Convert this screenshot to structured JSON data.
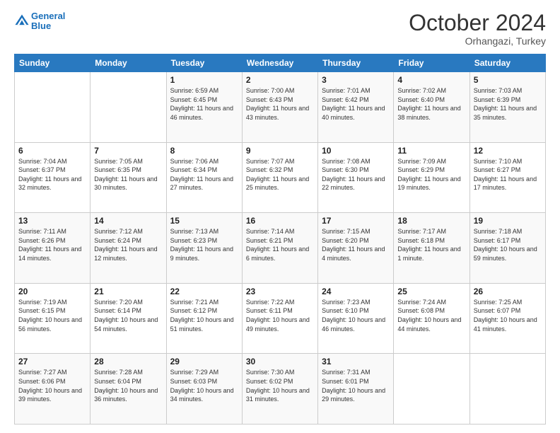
{
  "header": {
    "logo_line1": "General",
    "logo_line2": "Blue",
    "month_title": "October 2024",
    "location": "Orhangazi, Turkey"
  },
  "weekdays": [
    "Sunday",
    "Monday",
    "Tuesday",
    "Wednesday",
    "Thursday",
    "Friday",
    "Saturday"
  ],
  "weeks": [
    [
      {
        "day": "",
        "sunrise": "",
        "sunset": "",
        "daylight": ""
      },
      {
        "day": "",
        "sunrise": "",
        "sunset": "",
        "daylight": ""
      },
      {
        "day": "1",
        "sunrise": "Sunrise: 6:59 AM",
        "sunset": "Sunset: 6:45 PM",
        "daylight": "Daylight: 11 hours and 46 minutes."
      },
      {
        "day": "2",
        "sunrise": "Sunrise: 7:00 AM",
        "sunset": "Sunset: 6:43 PM",
        "daylight": "Daylight: 11 hours and 43 minutes."
      },
      {
        "day": "3",
        "sunrise": "Sunrise: 7:01 AM",
        "sunset": "Sunset: 6:42 PM",
        "daylight": "Daylight: 11 hours and 40 minutes."
      },
      {
        "day": "4",
        "sunrise": "Sunrise: 7:02 AM",
        "sunset": "Sunset: 6:40 PM",
        "daylight": "Daylight: 11 hours and 38 minutes."
      },
      {
        "day": "5",
        "sunrise": "Sunrise: 7:03 AM",
        "sunset": "Sunset: 6:39 PM",
        "daylight": "Daylight: 11 hours and 35 minutes."
      }
    ],
    [
      {
        "day": "6",
        "sunrise": "Sunrise: 7:04 AM",
        "sunset": "Sunset: 6:37 PM",
        "daylight": "Daylight: 11 hours and 32 minutes."
      },
      {
        "day": "7",
        "sunrise": "Sunrise: 7:05 AM",
        "sunset": "Sunset: 6:35 PM",
        "daylight": "Daylight: 11 hours and 30 minutes."
      },
      {
        "day": "8",
        "sunrise": "Sunrise: 7:06 AM",
        "sunset": "Sunset: 6:34 PM",
        "daylight": "Daylight: 11 hours and 27 minutes."
      },
      {
        "day": "9",
        "sunrise": "Sunrise: 7:07 AM",
        "sunset": "Sunset: 6:32 PM",
        "daylight": "Daylight: 11 hours and 25 minutes."
      },
      {
        "day": "10",
        "sunrise": "Sunrise: 7:08 AM",
        "sunset": "Sunset: 6:30 PM",
        "daylight": "Daylight: 11 hours and 22 minutes."
      },
      {
        "day": "11",
        "sunrise": "Sunrise: 7:09 AM",
        "sunset": "Sunset: 6:29 PM",
        "daylight": "Daylight: 11 hours and 19 minutes."
      },
      {
        "day": "12",
        "sunrise": "Sunrise: 7:10 AM",
        "sunset": "Sunset: 6:27 PM",
        "daylight": "Daylight: 11 hours and 17 minutes."
      }
    ],
    [
      {
        "day": "13",
        "sunrise": "Sunrise: 7:11 AM",
        "sunset": "Sunset: 6:26 PM",
        "daylight": "Daylight: 11 hours and 14 minutes."
      },
      {
        "day": "14",
        "sunrise": "Sunrise: 7:12 AM",
        "sunset": "Sunset: 6:24 PM",
        "daylight": "Daylight: 11 hours and 12 minutes."
      },
      {
        "day": "15",
        "sunrise": "Sunrise: 7:13 AM",
        "sunset": "Sunset: 6:23 PM",
        "daylight": "Daylight: 11 hours and 9 minutes."
      },
      {
        "day": "16",
        "sunrise": "Sunrise: 7:14 AM",
        "sunset": "Sunset: 6:21 PM",
        "daylight": "Daylight: 11 hours and 6 minutes."
      },
      {
        "day": "17",
        "sunrise": "Sunrise: 7:15 AM",
        "sunset": "Sunset: 6:20 PM",
        "daylight": "Daylight: 11 hours and 4 minutes."
      },
      {
        "day": "18",
        "sunrise": "Sunrise: 7:17 AM",
        "sunset": "Sunset: 6:18 PM",
        "daylight": "Daylight: 11 hours and 1 minute."
      },
      {
        "day": "19",
        "sunrise": "Sunrise: 7:18 AM",
        "sunset": "Sunset: 6:17 PM",
        "daylight": "Daylight: 10 hours and 59 minutes."
      }
    ],
    [
      {
        "day": "20",
        "sunrise": "Sunrise: 7:19 AM",
        "sunset": "Sunset: 6:15 PM",
        "daylight": "Daylight: 10 hours and 56 minutes."
      },
      {
        "day": "21",
        "sunrise": "Sunrise: 7:20 AM",
        "sunset": "Sunset: 6:14 PM",
        "daylight": "Daylight: 10 hours and 54 minutes."
      },
      {
        "day": "22",
        "sunrise": "Sunrise: 7:21 AM",
        "sunset": "Sunset: 6:12 PM",
        "daylight": "Daylight: 10 hours and 51 minutes."
      },
      {
        "day": "23",
        "sunrise": "Sunrise: 7:22 AM",
        "sunset": "Sunset: 6:11 PM",
        "daylight": "Daylight: 10 hours and 49 minutes."
      },
      {
        "day": "24",
        "sunrise": "Sunrise: 7:23 AM",
        "sunset": "Sunset: 6:10 PM",
        "daylight": "Daylight: 10 hours and 46 minutes."
      },
      {
        "day": "25",
        "sunrise": "Sunrise: 7:24 AM",
        "sunset": "Sunset: 6:08 PM",
        "daylight": "Daylight: 10 hours and 44 minutes."
      },
      {
        "day": "26",
        "sunrise": "Sunrise: 7:25 AM",
        "sunset": "Sunset: 6:07 PM",
        "daylight": "Daylight: 10 hours and 41 minutes."
      }
    ],
    [
      {
        "day": "27",
        "sunrise": "Sunrise: 7:27 AM",
        "sunset": "Sunset: 6:06 PM",
        "daylight": "Daylight: 10 hours and 39 minutes."
      },
      {
        "day": "28",
        "sunrise": "Sunrise: 7:28 AM",
        "sunset": "Sunset: 6:04 PM",
        "daylight": "Daylight: 10 hours and 36 minutes."
      },
      {
        "day": "29",
        "sunrise": "Sunrise: 7:29 AM",
        "sunset": "Sunset: 6:03 PM",
        "daylight": "Daylight: 10 hours and 34 minutes."
      },
      {
        "day": "30",
        "sunrise": "Sunrise: 7:30 AM",
        "sunset": "Sunset: 6:02 PM",
        "daylight": "Daylight: 10 hours and 31 minutes."
      },
      {
        "day": "31",
        "sunrise": "Sunrise: 7:31 AM",
        "sunset": "Sunset: 6:01 PM",
        "daylight": "Daylight: 10 hours and 29 minutes."
      },
      {
        "day": "",
        "sunrise": "",
        "sunset": "",
        "daylight": ""
      },
      {
        "day": "",
        "sunrise": "",
        "sunset": "",
        "daylight": ""
      }
    ]
  ]
}
